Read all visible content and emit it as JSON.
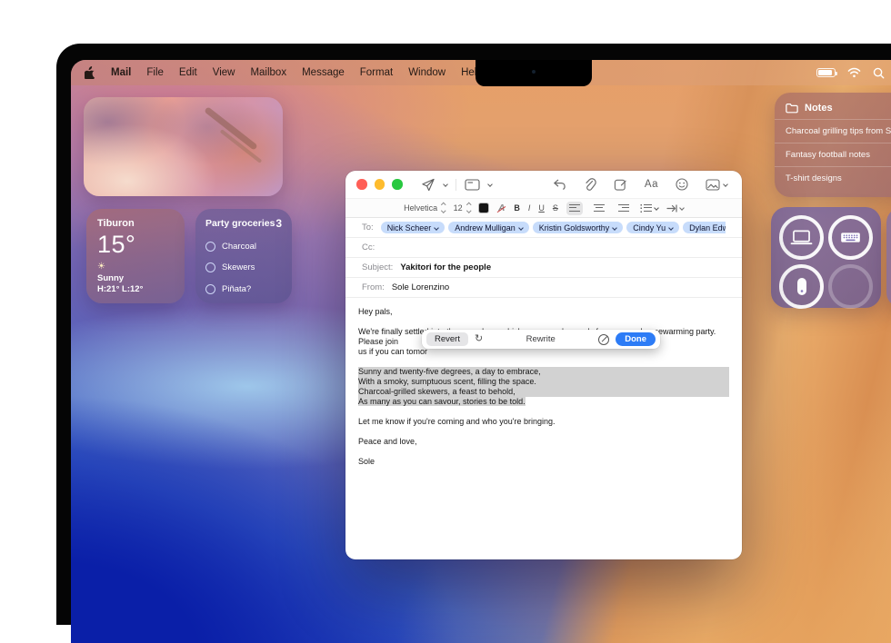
{
  "menu_bar": {
    "items": [
      "Mail",
      "File",
      "Edit",
      "View",
      "Mailbox",
      "Message",
      "Format",
      "Window",
      "Help"
    ]
  },
  "widgets": {
    "weather": {
      "city": "Tiburon",
      "temperature": "15°",
      "sun_glyph": "☀",
      "condition": "Sunny",
      "high_low": "H:21° L:12°"
    },
    "reminders": {
      "title": "Party groceries",
      "count": "3",
      "items": [
        "Charcoal",
        "Skewers",
        "Piñata?"
      ]
    },
    "notes": {
      "title": "Notes",
      "items": [
        "Charcoal grilling tips from Sh",
        "Fantasy football notes",
        "T-shirt designs"
      ]
    }
  },
  "mail_window": {
    "toolbar": {
      "aa_label": "Aa"
    },
    "format_bar": {
      "font_name": "Helvetica",
      "font_size": "12",
      "bold": "B",
      "italic": "I",
      "underline": "U",
      "strike": "S"
    },
    "fields": {
      "to_label": "To:",
      "recipients": [
        "Nick Scheer",
        "Andrew Mulligan",
        "Kristin Goldsworthy",
        "Cindy Yu",
        "Dylan Edwards"
      ],
      "cc_label": "Cc:",
      "subject_label": "Subject:",
      "subject_value": "Yakitori for the people",
      "from_label": "From:",
      "from_value": "Sole Lorenzino"
    },
    "body": {
      "greeting": "Hey pals,",
      "paragraph_line1": "We're finally settled into the new place, which means we're ready for a proper housewarming party. Please join",
      "paragraph_line2": "us if you can tomor",
      "poem": [
        "Sunny and twenty-five degrees, a day to embrace,",
        "With a smoky, sumptuous scent, filling the space.",
        "Charcoal-grilled skewers, a feast to behold,",
        "As many as you can savour, stories to be told."
      ],
      "follow_up": "Let me know if you're coming and who you're bringing.",
      "closing": "Peace and love,",
      "signature": "Sole"
    },
    "rewrite_toolbar": {
      "revert_label": "Revert",
      "title": "Rewrite",
      "done_label": "Done"
    }
  },
  "colors": {
    "accent_blue": "#2d7cf6",
    "recipient_pill_blue": "#c7dcfb",
    "selection_gray": "#d2d2d2",
    "traffic_red": "#ff5f57",
    "traffic_yellow": "#febc2e",
    "traffic_green": "#28c840"
  }
}
